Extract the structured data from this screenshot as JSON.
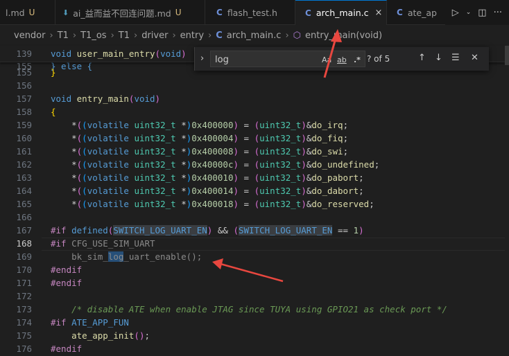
{
  "tabs": [
    {
      "label": "l.md",
      "status": "U",
      "icon": "markdown-icon"
    },
    {
      "label": "ai_益而益不回连问题.md",
      "status": "U",
      "icon": "download-icon"
    },
    {
      "label": "flash_test.h",
      "icon": "c-file-icon",
      "icon_text": "C"
    },
    {
      "label": "arch_main.c",
      "icon": "c-file-icon",
      "icon_text": "C",
      "active": true,
      "close": "×"
    },
    {
      "label": "ate_ap",
      "icon": "c-file-icon",
      "icon_text": "C"
    }
  ],
  "breadcrumb": [
    "vendor",
    "T1",
    "T1_os",
    "T1",
    "driver",
    "entry",
    "arch_main.c",
    "entry_main(void)"
  ],
  "breadcrumb_sep": "›",
  "find": {
    "query": "log",
    "match_case": "Aa",
    "whole_word": "ab",
    "regex": ".*",
    "count": "? of 5"
  },
  "sticky": {
    "line_no": "139",
    "partial_line_no": "155"
  },
  "lines": {
    "n155": "155",
    "n156": "156",
    "n157": "157",
    "n158": "158",
    "n159": "159",
    "n160": "160",
    "n161": "161",
    "n162": "162",
    "n163": "163",
    "n164": "164",
    "n165": "165",
    "n166": "166",
    "n167": "167",
    "n168": "168",
    "n169": "169",
    "n170": "170",
    "n171": "171",
    "n172": "172",
    "n173": "173",
    "n174": "174",
    "n175": "175",
    "n176": "176"
  },
  "colors": {
    "accent": "#0078d4",
    "arrow": "#e8473f",
    "find_highlight": "#264f78"
  }
}
